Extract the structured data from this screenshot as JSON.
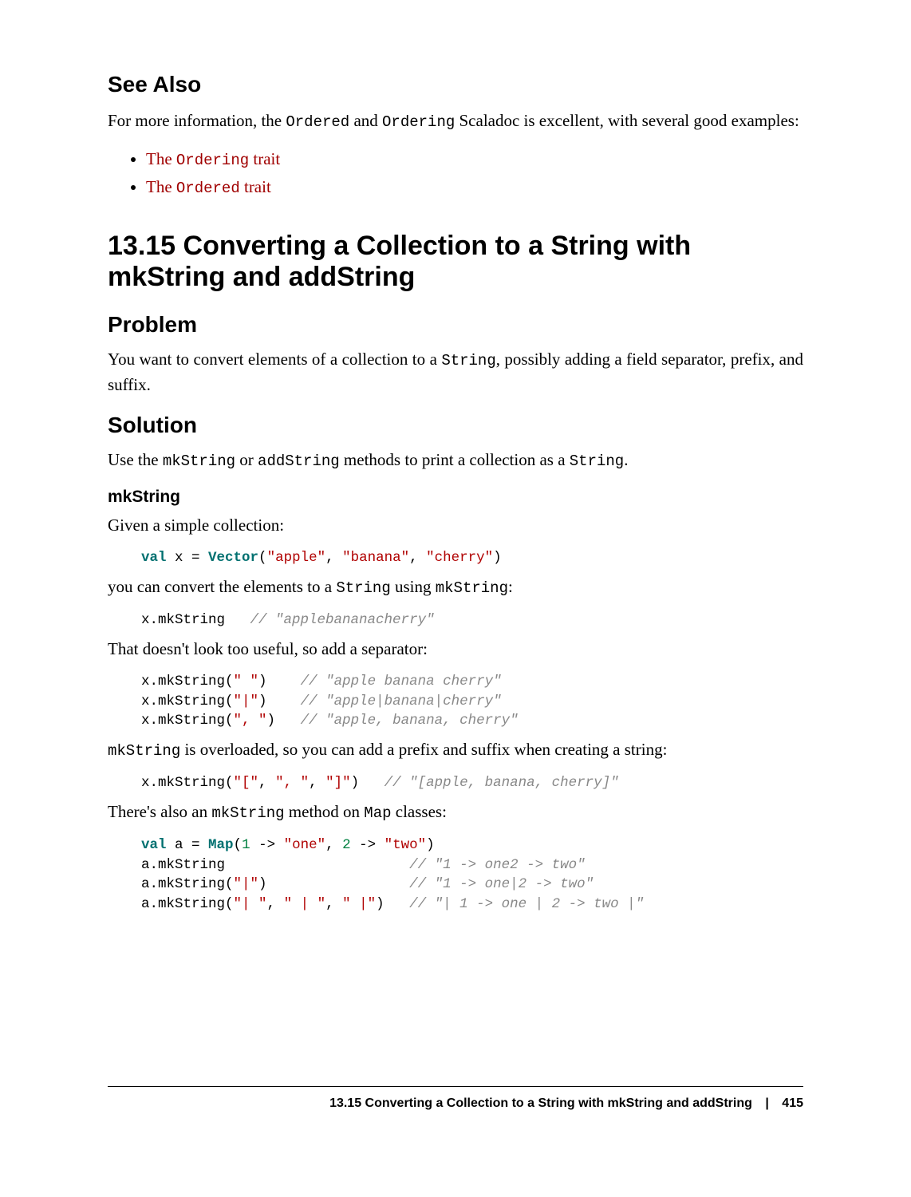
{
  "see_also": {
    "heading": "See Also",
    "intro_pre": "For more information, the ",
    "intro_code1": "Ordered",
    "intro_mid": " and ",
    "intro_code2": "Ordering",
    "intro_post": " Scaladoc is excellent, with several good examples:",
    "links": [
      {
        "pre": "The ",
        "code": "Ordering",
        "post": " trait"
      },
      {
        "pre": "The ",
        "code": "Ordered",
        "post": " trait"
      }
    ]
  },
  "section": {
    "title": "13.15 Converting a Collection to a String with mkString and addString"
  },
  "problem": {
    "heading": "Problem",
    "text_pre": "You want to convert elements of a collection to a ",
    "text_code": "String",
    "text_post": ", possibly adding a field separator, prefix, and suffix."
  },
  "solution": {
    "heading": "Solution",
    "intro_pre": "Use the ",
    "intro_c1": "mkString",
    "intro_mid": " or ",
    "intro_c2": "addString",
    "intro_mid2": " methods to print a collection as a ",
    "intro_c3": "String",
    "intro_post": "."
  },
  "mkstring": {
    "heading": "mkString",
    "p1": "Given a simple collection:",
    "code1": {
      "kw1": "val",
      "var1": " x = ",
      "cls1": "Vector",
      "paren_open": "(",
      "s1": "\"apple\"",
      "c1": ", ",
      "s2": "\"banana\"",
      "c2": ", ",
      "s3": "\"cherry\"",
      "paren_close": ")"
    },
    "p2_pre": "you can convert the elements to a ",
    "p2_c1": "String",
    "p2_mid": " using ",
    "p2_c2": "mkString",
    "p2_post": ":",
    "code2": {
      "call": "x.mkString   ",
      "cm": "// \"applebananacherry\""
    },
    "p3": "That doesn't look too useful, so add a separator:",
    "code3": {
      "l1a": "x.mkString(",
      "l1s": "\" \"",
      "l1b": ")    ",
      "l1c": "// \"apple banana cherry\"",
      "l2a": "x.mkString(",
      "l2s": "\"|\"",
      "l2b": ")    ",
      "l2c": "// \"apple|banana|cherry\"",
      "l3a": "x.mkString(",
      "l3s": "\", \"",
      "l3b": ")   ",
      "l3c": "// \"apple, banana, cherry\""
    },
    "p4_c1": "mkString",
    "p4_post": " is overloaded, so you can add a prefix and suffix when creating a string:",
    "code4": {
      "a": "x.mkString(",
      "s1": "\"[\"",
      "c1": ", ",
      "s2": "\", \"",
      "c2": ", ",
      "s3": "\"]\"",
      "b": ")   ",
      "cm": "// \"[apple, banana, cherry]\""
    },
    "p5_pre": "There's also an ",
    "p5_c1": "mkString",
    "p5_mid": " method on ",
    "p5_c2": "Map",
    "p5_post": " classes:",
    "code5": {
      "l1_kw": "val",
      "l1_a": " a = ",
      "l1_cls": "Map",
      "l1_b": "(",
      "l1_n1": "1",
      "l1_c": " -> ",
      "l1_s1": "\"one\"",
      "l1_d": ", ",
      "l1_n2": "2",
      "l1_e": " -> ",
      "l1_s2": "\"two\"",
      "l1_f": ")",
      "l2_a": "a.mkString                      ",
      "l2_cm": "// \"1 -> one2 -> two\"",
      "l3_a": "a.mkString(",
      "l3_s": "\"|\"",
      "l3_b": ")                 ",
      "l3_cm": "// \"1 -> one|2 -> two\"",
      "l4_a": "a.mkString(",
      "l4_s1": "\"| \"",
      "l4_c1": ", ",
      "l4_s2": "\" | \"",
      "l4_c2": ", ",
      "l4_s3": "\" |\"",
      "l4_b": ")   ",
      "l4_cm": "// \"| 1 -> one | 2 -> two |\""
    }
  },
  "footer": {
    "title": "13.15 Converting a Collection to a String with mkString and addString",
    "page": "415"
  }
}
